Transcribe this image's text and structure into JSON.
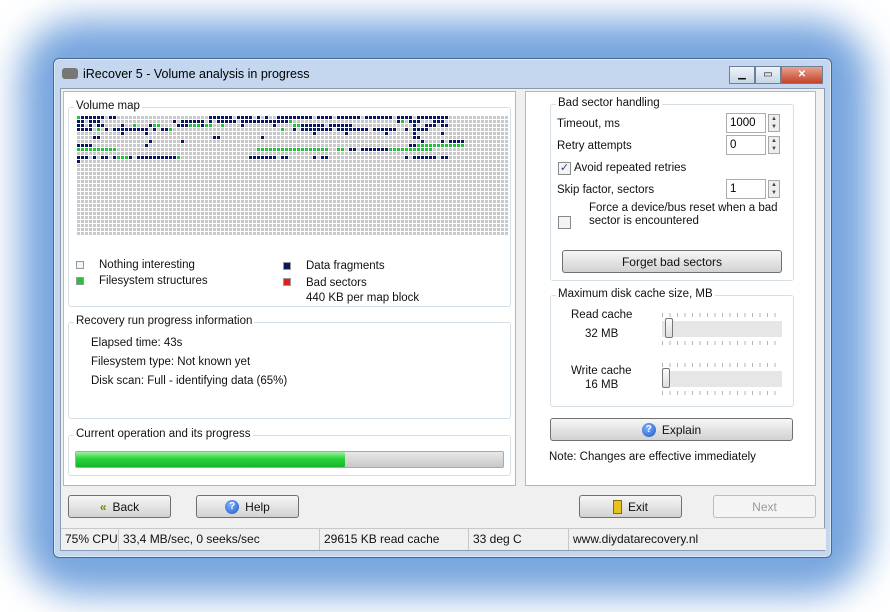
{
  "window": {
    "title": "iRecover 5 - Volume analysis in progress",
    "minimize": "▁",
    "maximize": "▭",
    "close": "✕"
  },
  "volume_map": {
    "title": "Volume map",
    "columns": 108,
    "rows": 30,
    "cells": [
      "gdddddd.dd.......................dddddd.dddd.d.d..ddddddddd.dddd.dddddd.ddddddd.dddd.dddddddd",
      "dd.ddd..................d.dddddd.d.ddddd.ddddddddddddg..........................dg.ddd...ddd",
      "dd.d.dd....d..g...dgg....dddgggdgg..g....d.......d....ggdddddd.dddddd...............d..ddd.dd",
      "dddd.g.d.ddddddddd.d.ddg...........................g..d.dddddddd.dddddddd.dddddd..d.dddd",
      "...........d.....d.........................................d.......d.........d......d......d",
      "....dd............................dd..........d.....................................dd",
      "..................d.......d...........................................................d....d.dddd",
      "dddd.............d.................................................................ddgggggggggggg",
      "gggggggggg...................................gggggggggggggggggg..gg.dd.dddddddggggggggggg",
      "",
      "ddd.d.dd.dgggd.ddddddddddg.................ddddddd.dd......d.dd...................d.dddddd.dd",
      "d"
    ],
    "legend": {
      "nothing": "Nothing interesting",
      "filesystem": "Filesystem structures",
      "data": "Data fragments",
      "bad": "Bad sectors",
      "block_size": "440 KB per map block"
    }
  },
  "progress_info": {
    "title": "Recovery run progress information",
    "elapsed": "Elapsed time: 43s",
    "fs_type": "Filesystem type: Not known yet",
    "disk_scan": "Disk scan: Full - identifying data (65%)"
  },
  "current_op": {
    "title": "Current operation and its progress",
    "progress": 0.63
  },
  "bad_sector": {
    "title": "Bad sector handling",
    "timeout_label": "Timeout, ms",
    "timeout": "1000",
    "retry_label": "Retry attempts",
    "retry": "0",
    "avoid_label": "Avoid repeated retries",
    "avoid_checked": true,
    "skip_label": "Skip factor, sectors",
    "skip": "1",
    "reset_label": "Force a device/bus reset when a bad sector is encountered",
    "reset_checked": false,
    "forget_button": "Forget bad sectors"
  },
  "cache": {
    "title": "Maximum disk cache size, MB",
    "read_label": "Read cache",
    "read_value": "32 MB",
    "read_fraction": 0.03,
    "write_label": "Write cache",
    "write_value": "16 MB",
    "write_fraction": 0.0
  },
  "explain_button": "Explain",
  "note": "Note: Changes are effective immediately",
  "buttons": {
    "back": "Back",
    "help": "Help",
    "exit": "Exit",
    "next": "Next"
  },
  "status": {
    "cpu": "75% CPU",
    "throughput": "33,4 MB/sec, 0 seeks/sec",
    "read_cache": "29615 KB read cache",
    "temp": "33 deg C",
    "website": "www.diydatarecovery.nl"
  }
}
